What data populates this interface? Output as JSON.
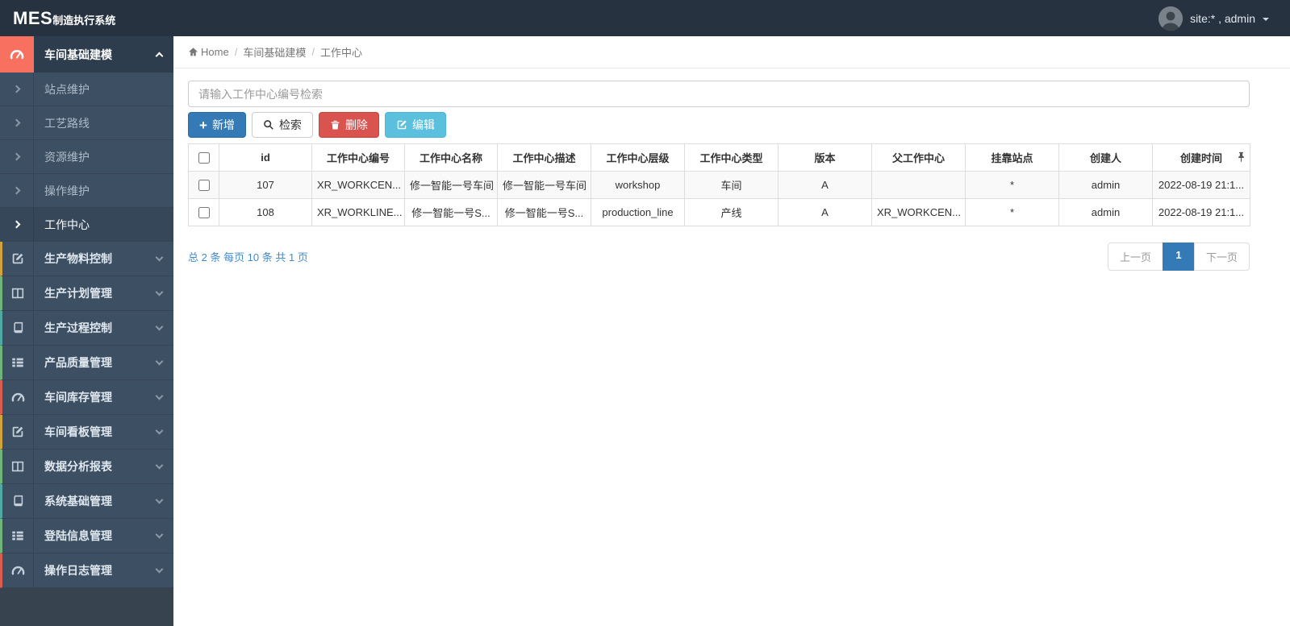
{
  "topbar": {
    "logo_main": "MES",
    "logo_sub": "制造执行系统",
    "user_label": "site:* , admin"
  },
  "sidebar": {
    "active_parent": {
      "label": "车间基础建模",
      "accent": "#f8705f"
    },
    "sub_items": [
      {
        "label": "站点维护"
      },
      {
        "label": "工艺路线"
      },
      {
        "label": "资源维护"
      },
      {
        "label": "操作维护"
      },
      {
        "label": "工作中心",
        "active": true
      }
    ],
    "parent_items": [
      {
        "label": "生产物料控制",
        "icon": "pencil-icon",
        "stripe": "#d4a43c"
      },
      {
        "label": "生产计划管理",
        "icon": "columns-icon",
        "stripe": "#6fb579"
      },
      {
        "label": "生产过程控制",
        "icon": "book-icon",
        "stripe": "#4fa9a4"
      },
      {
        "label": "产品质量管理",
        "icon": "list-icon",
        "stripe": "#6fb579"
      },
      {
        "label": "车间库存管理",
        "icon": "gauge-icon",
        "stripe": "#d95c4e"
      },
      {
        "label": "车间看板管理",
        "icon": "pencil-icon",
        "stripe": "#d4a43c"
      },
      {
        "label": "数据分析报表",
        "icon": "columns-icon",
        "stripe": "#6fb579"
      },
      {
        "label": "系统基础管理",
        "icon": "book-icon",
        "stripe": "#4fa9a4"
      },
      {
        "label": "登陆信息管理",
        "icon": "list-icon",
        "stripe": "#6fb579"
      },
      {
        "label": "操作日志管理",
        "icon": "gauge-icon",
        "stripe": "#d95c4e"
      }
    ]
  },
  "breadcrumb": {
    "home": "Home",
    "separator": "/",
    "items": [
      "车间基础建模",
      "工作中心"
    ]
  },
  "search": {
    "placeholder": "请输入工作中心编号检索"
  },
  "toolbar": {
    "add": "新增",
    "search": "检索",
    "delete": "删除",
    "edit": "编辑"
  },
  "table": {
    "headers": [
      "id",
      "工作中心编号",
      "工作中心名称",
      "工作中心描述",
      "工作中心层级",
      "工作中心类型",
      "版本",
      "父工作中心",
      "挂靠站点",
      "创建人",
      "创建时间"
    ],
    "rows": [
      {
        "cells": [
          "107",
          "XR_WORKCEN...",
          "修一智能一号车间",
          "修一智能一号车间",
          "workshop",
          "车间",
          "A",
          "",
          "*",
          "admin",
          "2022-08-19 21:1..."
        ]
      },
      {
        "cells": [
          "108",
          "XR_WORKLINE...",
          "修一智能一号S...",
          "修一智能一号S...",
          "production_line",
          "产线",
          "A",
          "XR_WORKCEN...",
          "*",
          "admin",
          "2022-08-19 21:1..."
        ]
      }
    ]
  },
  "pagination": {
    "summary": "总 2 条  每页 10 条  共 1 页",
    "prev": "上一页",
    "page": "1",
    "next": "下一页"
  },
  "colors": {
    "topbar_bg": "#263240",
    "sidebar_bg": "#3d4f62",
    "active_accent": "#f8705f",
    "primary": "#337ab7",
    "danger": "#d9534f",
    "info": "#5bc0de",
    "pagination_active": "#337ab7"
  }
}
